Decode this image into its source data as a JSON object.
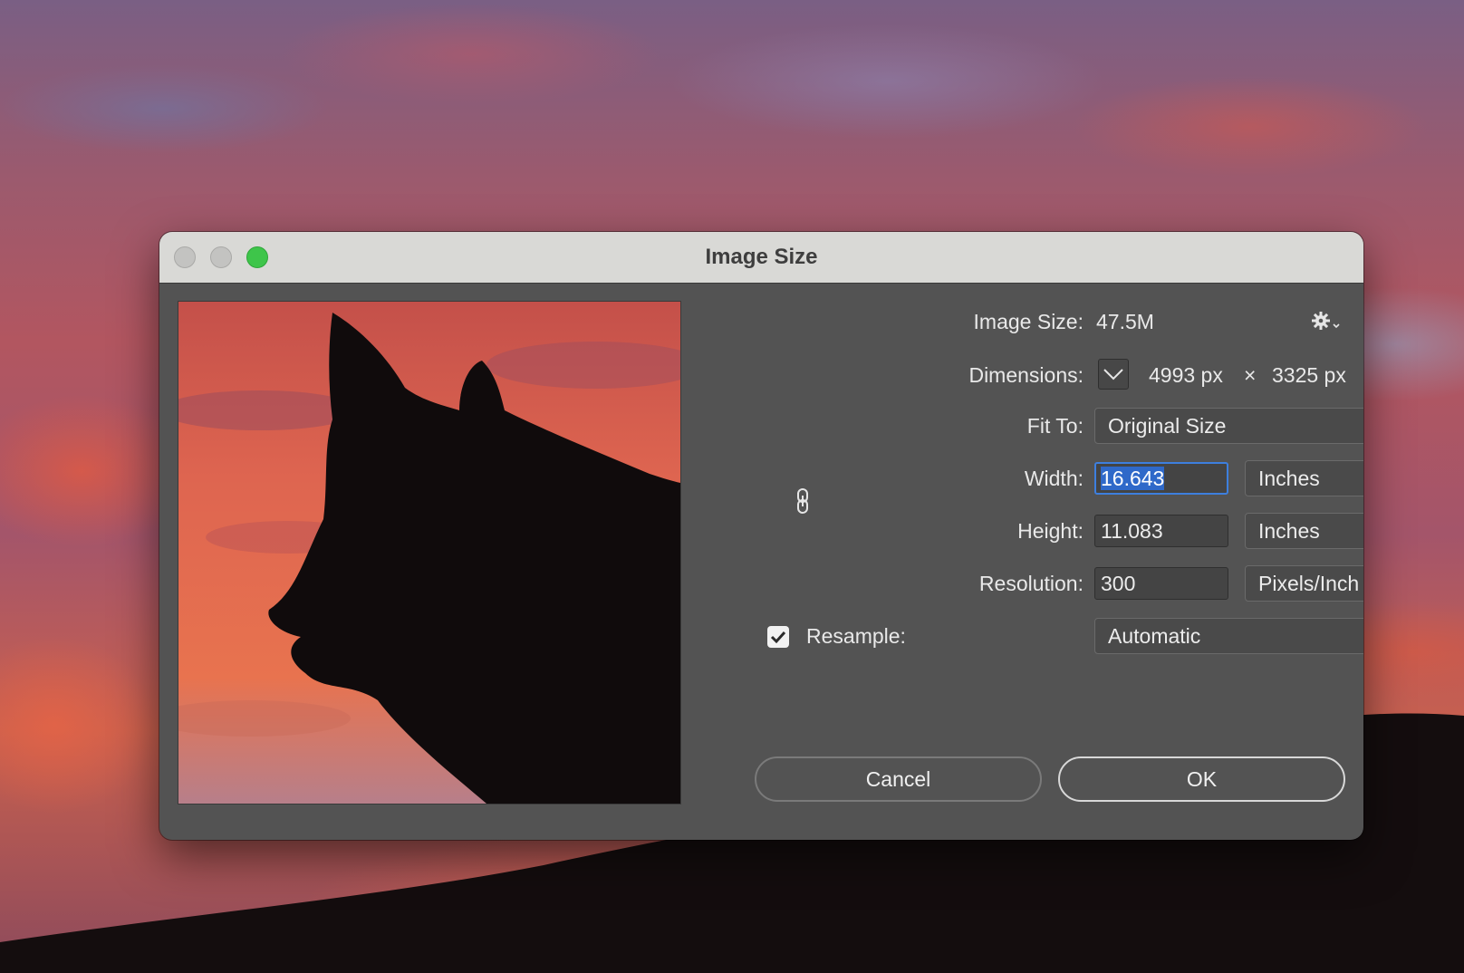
{
  "dialog": {
    "title": "Image Size"
  },
  "info": {
    "image_size_label": "Image Size:",
    "image_size_value": "47.5M",
    "dimensions_label": "Dimensions:",
    "dimensions_width": "4993 px",
    "dimensions_sep": "×",
    "dimensions_height": "3325 px"
  },
  "fit_to": {
    "label": "Fit To:",
    "value": "Original Size"
  },
  "width": {
    "label": "Width:",
    "value": "16.643",
    "unit": "Inches"
  },
  "height": {
    "label": "Height:",
    "value": "11.083",
    "unit": "Inches"
  },
  "resolution": {
    "label": "Resolution:",
    "value": "300",
    "unit": "Pixels/Inch"
  },
  "resample": {
    "label": "Resample:",
    "checked": true,
    "value": "Automatic"
  },
  "buttons": {
    "cancel": "Cancel",
    "ok": "OK"
  },
  "colors": {
    "dialog_bg": "#535353",
    "titlebar_bg": "#d9d9d6",
    "focus_ring": "#3d7fde",
    "zoom_button": "#3ec54a"
  },
  "icons": {
    "settings": "gear-icon",
    "link": "chain-link-icon",
    "dimensions_toggle": "chevron-down-icon",
    "dropdown": "chevron-down-icon",
    "resample_check": "checkmark-icon"
  }
}
